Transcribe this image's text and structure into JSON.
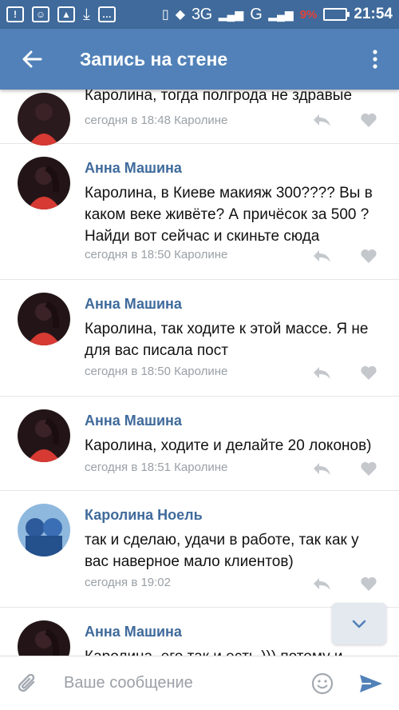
{
  "status_bar": {
    "network": "3G",
    "network2": "G",
    "battery_pct": "9%",
    "time": "21:54"
  },
  "header": {
    "title": "Запись на стене",
    "back_icon": "arrow-left-icon",
    "menu_icon": "more-vertical-icon"
  },
  "comments": [
    {
      "author": "",
      "text": "Каролина, тогда полгрода не здравые",
      "meta": "сегодня в 18:48 Каролине"
    },
    {
      "author": "Анна Машина",
      "text": "Каролина, в Киеве макияж 300???? Вы в каком веке живёте? А причёсок за 500 ? Найди вот сейчас и скиньте сюда",
      "meta": "сегодня в 18:50 Каролине"
    },
    {
      "author": "Анна Машина",
      "text": "Каролина, так ходите к этой массе. Я не для вас писала пост",
      "meta": "сегодня в 18:50 Каролине"
    },
    {
      "author": "Анна Машина",
      "text": "Каролина, ходите и делайте 20 локонов)",
      "meta": "сегодня в 18:51 Каролине"
    },
    {
      "author": "Каролина Ноель",
      "text": "так и сделаю, удачи в работе, так как у вас наверное мало клиентов)",
      "meta": "сегодня в 19:02"
    },
    {
      "author": "Анна Машина",
      "text": "Каролина, его так и есть ))) потому и",
      "meta": ""
    }
  ],
  "composer": {
    "placeholder": "Ваше сообщение"
  },
  "colors": {
    "status_bar": "#3f6a9b",
    "app_bar": "#5181b8",
    "author": "#3f6a9b",
    "meta": "#9aa0a6"
  }
}
